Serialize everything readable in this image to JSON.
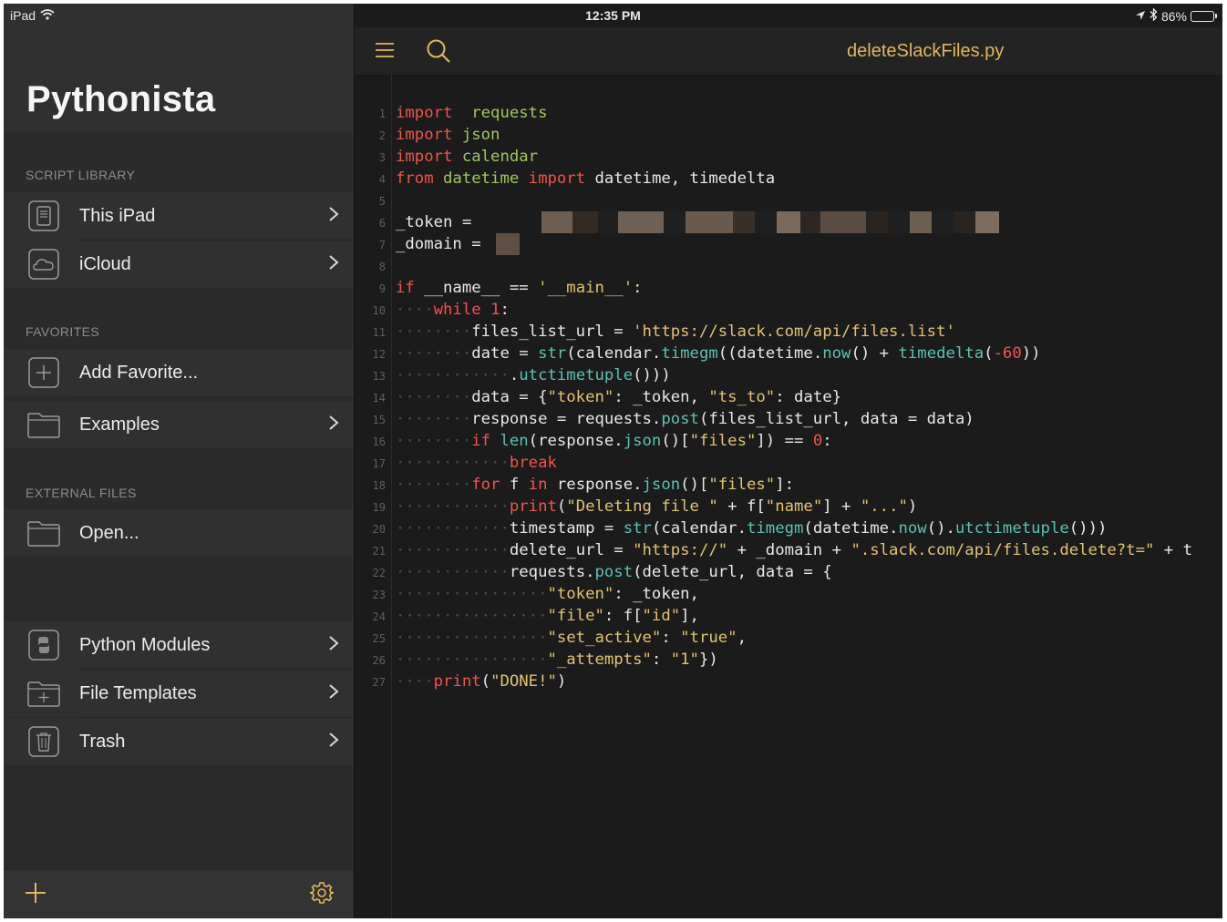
{
  "status_bar": {
    "device": "iPad",
    "time": "12:35 PM",
    "battery_text": "86%",
    "battery_level": 0.86
  },
  "sidebar": {
    "title": "Pythonista",
    "sections": {
      "script_library": "SCRIPT LIBRARY",
      "favorites": "FAVORITES",
      "external_files": "EXTERNAL FILES"
    },
    "items": {
      "this_ipad": "This iPad",
      "icloud": "iCloud",
      "add_favorite": "Add Favorite...",
      "examples": "Examples",
      "open": "Open...",
      "python_modules": "Python Modules",
      "file_templates": "File Templates",
      "trash": "Trash"
    }
  },
  "editor": {
    "file_name": "deleteSlackFiles.py",
    "code_lines": [
      {
        "n": "1",
        "indent": 0,
        "t": [
          [
            "kw",
            "import"
          ],
          [
            "",
            "  "
          ],
          [
            "mod",
            "requests"
          ]
        ]
      },
      {
        "n": "2",
        "indent": 0,
        "t": [
          [
            "kw",
            "import"
          ],
          [
            "",
            " "
          ],
          [
            "mod",
            "json"
          ]
        ]
      },
      {
        "n": "3",
        "indent": 0,
        "t": [
          [
            "kw",
            "import"
          ],
          [
            "",
            " "
          ],
          [
            "mod",
            "calendar"
          ]
        ]
      },
      {
        "n": "4",
        "indent": 0,
        "t": [
          [
            "kw",
            "from"
          ],
          [
            "",
            " "
          ],
          [
            "mod",
            "datetime"
          ],
          [
            "",
            " "
          ],
          [
            "kw",
            "import"
          ],
          [
            "",
            " datetime, timedelta"
          ]
        ]
      },
      {
        "n": "5",
        "indent": 0,
        "t": []
      },
      {
        "n": "6",
        "indent": 0,
        "t": [
          [
            "",
            "_token = "
          ]
        ]
      },
      {
        "n": "7",
        "indent": 0,
        "t": [
          [
            "",
            "_domain = "
          ]
        ]
      },
      {
        "n": "8",
        "indent": 0,
        "t": []
      },
      {
        "n": "9",
        "indent": 0,
        "t": [
          [
            "kw",
            "if"
          ],
          [
            "",
            " __name__ == "
          ],
          [
            "str",
            "'__main__'"
          ],
          [
            "",
            ":"
          ]
        ]
      },
      {
        "n": "10",
        "indent": 4,
        "t": [
          [
            "kw",
            "while"
          ],
          [
            "",
            " "
          ],
          [
            "num",
            "1"
          ],
          [
            "",
            ":"
          ]
        ]
      },
      {
        "n": "11",
        "indent": 8,
        "t": [
          [
            "",
            "files_list_url = "
          ],
          [
            "str",
            "'https://slack.com/api/files.list'"
          ]
        ]
      },
      {
        "n": "12",
        "indent": 8,
        "t": [
          [
            "",
            "date = "
          ],
          [
            "fn",
            "str"
          ],
          [
            "",
            "(calendar."
          ],
          [
            "fn",
            "timegm"
          ],
          [
            "",
            "((datetime."
          ],
          [
            "fn",
            "now"
          ],
          [
            "",
            "() + "
          ],
          [
            "fn",
            "timedelta"
          ],
          [
            "",
            "("
          ],
          [
            "num",
            "-60"
          ],
          [
            "",
            "))"
          ]
        ]
      },
      {
        "n": "13",
        "indent": 12,
        "t": [
          [
            "",
            "."
          ],
          [
            "fn",
            "utctimetuple"
          ],
          [
            "",
            "()))"
          ]
        ]
      },
      {
        "n": "14",
        "indent": 8,
        "t": [
          [
            "",
            "data = {"
          ],
          [
            "str",
            "\"token\""
          ],
          [
            "",
            ": _token, "
          ],
          [
            "str",
            "\"ts_to\""
          ],
          [
            "",
            ": date}"
          ]
        ]
      },
      {
        "n": "15",
        "indent": 8,
        "t": [
          [
            "",
            "response = requests."
          ],
          [
            "fn",
            "post"
          ],
          [
            "",
            "(files_list_url, data = data)"
          ]
        ]
      },
      {
        "n": "16",
        "indent": 8,
        "t": [
          [
            "kw",
            "if"
          ],
          [
            "",
            " "
          ],
          [
            "fn",
            "len"
          ],
          [
            "",
            "(response."
          ],
          [
            "fn",
            "json"
          ],
          [
            "",
            "()["
          ],
          [
            "str",
            "\"files\""
          ],
          [
            "",
            "]) == "
          ],
          [
            "num",
            "0"
          ],
          [
            "",
            ":"
          ]
        ]
      },
      {
        "n": "17",
        "indent": 12,
        "t": [
          [
            "kw",
            "break"
          ]
        ]
      },
      {
        "n": "18",
        "indent": 8,
        "t": [
          [
            "kw",
            "for"
          ],
          [
            "",
            " f "
          ],
          [
            "kw",
            "in"
          ],
          [
            "",
            " response."
          ],
          [
            "fn",
            "json"
          ],
          [
            "",
            "()["
          ],
          [
            "str",
            "\"files\""
          ],
          [
            "",
            "]:"
          ]
        ]
      },
      {
        "n": "19",
        "indent": 12,
        "t": [
          [
            "kw",
            "print"
          ],
          [
            "",
            "("
          ],
          [
            "str",
            "\"Deleting file \""
          ],
          [
            "",
            " + f["
          ],
          [
            "str",
            "\"name\""
          ],
          [
            "",
            "] + "
          ],
          [
            "str",
            "\"...\""
          ],
          [
            "",
            ")"
          ]
        ]
      },
      {
        "n": "20",
        "indent": 12,
        "t": [
          [
            "",
            "timestamp = "
          ],
          [
            "fn",
            "str"
          ],
          [
            "",
            "(calendar."
          ],
          [
            "fn",
            "timegm"
          ],
          [
            "",
            "(datetime."
          ],
          [
            "fn",
            "now"
          ],
          [
            "",
            "()."
          ],
          [
            "fn",
            "utctimetuple"
          ],
          [
            "",
            "()))"
          ]
        ]
      },
      {
        "n": "21",
        "indent": 12,
        "t": [
          [
            "",
            "delete_url = "
          ],
          [
            "str",
            "\"https://\""
          ],
          [
            "",
            " + _domain + "
          ],
          [
            "str",
            "\".slack.com/api/files.delete?t=\""
          ],
          [
            "",
            " + t"
          ]
        ]
      },
      {
        "n": "22",
        "indent": 12,
        "t": [
          [
            "",
            "requests."
          ],
          [
            "fn",
            "post"
          ],
          [
            "",
            "(delete_url, data = {"
          ]
        ]
      },
      {
        "n": "23",
        "indent": 16,
        "t": [
          [
            "str",
            "\"token\""
          ],
          [
            "",
            ": _token,"
          ]
        ]
      },
      {
        "n": "24",
        "indent": 16,
        "t": [
          [
            "str",
            "\"file\""
          ],
          [
            "",
            ": f["
          ],
          [
            "str",
            "\"id\""
          ],
          [
            "",
            "],"
          ]
        ]
      },
      {
        "n": "25",
        "indent": 16,
        "t": [
          [
            "str",
            "\"set_active\""
          ],
          [
            "",
            ": "
          ],
          [
            "str",
            "\"true\""
          ],
          [
            "",
            ","
          ]
        ]
      },
      {
        "n": "26",
        "indent": 16,
        "t": [
          [
            "str",
            "\"_attempts\""
          ],
          [
            "",
            ": "
          ],
          [
            "str",
            "\"1\""
          ],
          [
            "",
            "})"
          ]
        ]
      },
      {
        "n": "27",
        "indent": 4,
        "t": [
          [
            "kw",
            "print"
          ],
          [
            "",
            "("
          ],
          [
            "str",
            "\"DONE!\""
          ],
          [
            "",
            ")"
          ]
        ]
      }
    ]
  },
  "colors": {
    "keyword": "#f0544d",
    "module": "#a1c660",
    "function": "#5cc1b2",
    "string": "#e2c274",
    "title": "#e0b75c"
  },
  "icons": {
    "wifi": "wifi-icon",
    "location": "location-arrow-icon",
    "bluetooth": "bluetooth-icon",
    "battery": "battery-icon",
    "menu": "hamburger-menu-icon",
    "search": "search-icon",
    "add": "plus-icon",
    "settings": "gear-icon"
  }
}
